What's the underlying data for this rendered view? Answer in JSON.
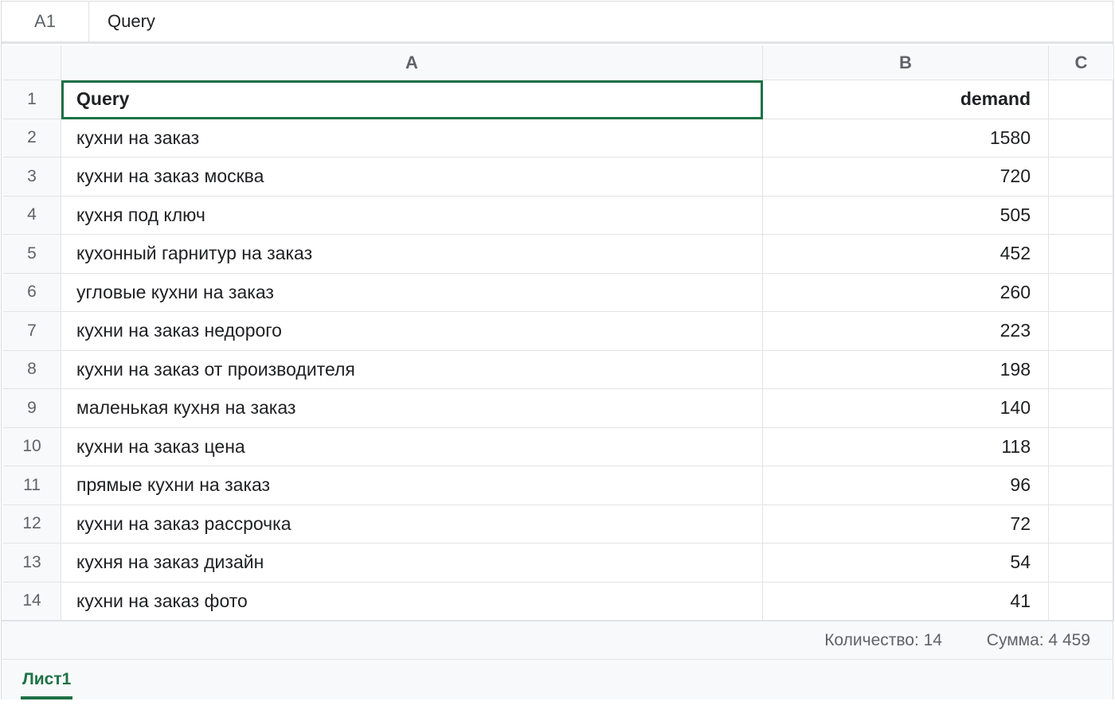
{
  "formula_bar": {
    "cell_ref": "A1",
    "value": "Query"
  },
  "columns": [
    "A",
    "B",
    "C"
  ],
  "rows": [
    {
      "n": "1",
      "a": "Query",
      "b": "demand"
    },
    {
      "n": "2",
      "a": "кухни на заказ",
      "b": "1580"
    },
    {
      "n": "3",
      "a": "кухни на заказ москва",
      "b": "720"
    },
    {
      "n": "4",
      "a": "кухня под ключ",
      "b": "505"
    },
    {
      "n": "5",
      "a": "кухонный гарнитур на заказ",
      "b": "452"
    },
    {
      "n": "6",
      "a": "угловые кухни на заказ",
      "b": "260"
    },
    {
      "n": "7",
      "a": "кухни на заказ недорого",
      "b": "223"
    },
    {
      "n": "8",
      "a": "кухни на заказ от производителя",
      "b": "198"
    },
    {
      "n": "9",
      "a": "маленькая кухня на заказ",
      "b": "140"
    },
    {
      "n": "10",
      "a": "кухни на заказ цена",
      "b": "118"
    },
    {
      "n": "11",
      "a": "прямые кухни на заказ",
      "b": "96"
    },
    {
      "n": "12",
      "a": "кухни на заказ рассрочка",
      "b": "72"
    },
    {
      "n": "13",
      "a": "кухня на заказ дизайн",
      "b": "54"
    },
    {
      "n": "14",
      "a": "кухни на заказ фото",
      "b": "41"
    }
  ],
  "status": {
    "count": "Количество: 14",
    "sum": "Сумма: 4 459"
  },
  "sheets": [
    {
      "label": "Лист1"
    }
  ],
  "colors": {
    "accent": "#1e7145"
  }
}
